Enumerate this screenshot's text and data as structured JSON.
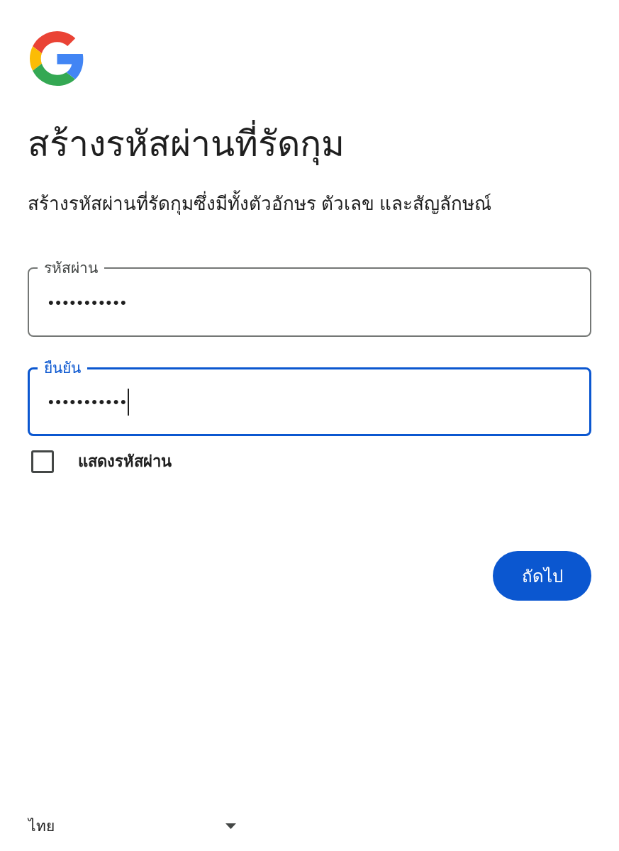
{
  "heading": "สร้างรหัสผ่านที่รัดกุม",
  "description": "สร้างรหัสผ่านที่รัดกุมซึ่งมีทั้งตัวอักษร ตัวเลข และสัญลักษณ์",
  "fields": [
    {
      "label": "รหัสผ่าน",
      "value": "•••••••••••",
      "focused": false
    },
    {
      "label": "ยืนยัน",
      "value": "•••••••••••",
      "focused": true
    }
  ],
  "show_password": {
    "label": "แสดงรหัสผ่าน",
    "checked": false
  },
  "next_button": {
    "label": "ถัดไป"
  },
  "footer": {
    "language": "ไทย"
  }
}
